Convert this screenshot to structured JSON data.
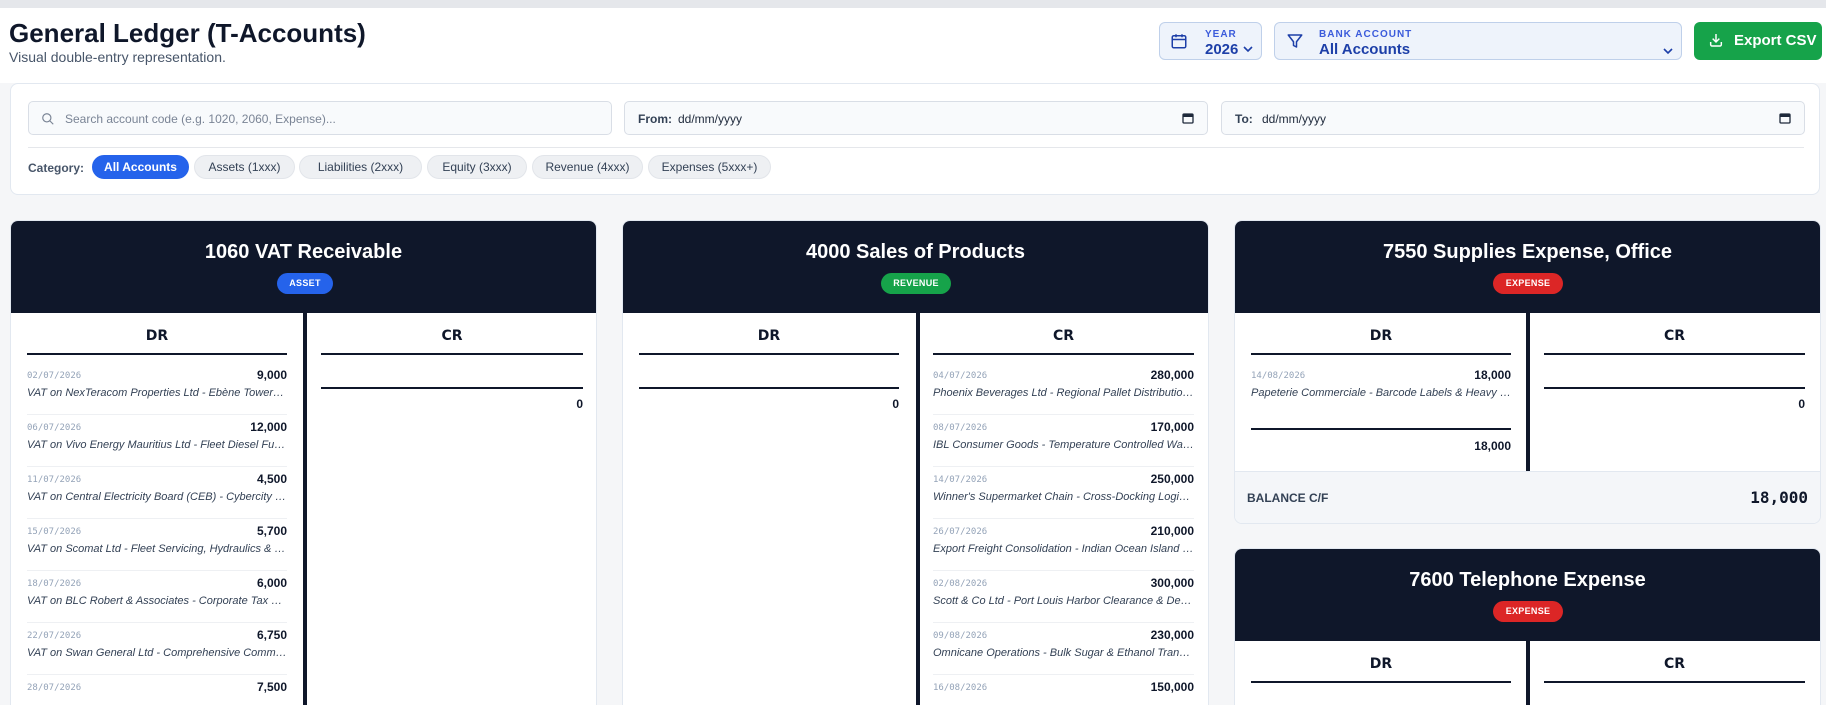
{
  "page": {
    "title": "General Ledger (T-Accounts)",
    "subtitle": "Visual double-entry representation."
  },
  "year_selector": {
    "label": "YEAR",
    "value": "2026"
  },
  "bank_selector": {
    "label": "BANK ACCOUNT",
    "value": "All Accounts"
  },
  "export_button": {
    "label": "Export CSV"
  },
  "filters": {
    "search_placeholder": "Search account code (e.g. 1020, 2060, Expense)...",
    "from_label": "From:",
    "from_value": "dd/mm/yyyy",
    "to_label": "To:",
    "to_value": "dd/mm/yyyy",
    "category_label": "Category:",
    "categories": [
      "All Accounts",
      "Assets (1xxx)",
      "Liabilities (2xxx)",
      "Equity (3xxx)",
      "Revenue (4xxx)",
      "Expenses (5xxx+)"
    ],
    "active_category": "All Accounts"
  },
  "accounts": [
    {
      "title": "1060 VAT Receivable",
      "badge": "ASSET",
      "dr_label": "DR",
      "cr_label": "CR",
      "dr_entries": [
        {
          "date": "02/07/2026",
          "amount": "9,000",
          "desc": "VAT on NexTeracom Properties Ltd - Ebène Tower II Office Rent"
        },
        {
          "date": "06/07/2026",
          "amount": "12,000",
          "desc": "VAT on Vivo Energy Mauritius Ltd - Fleet Diesel Fuel Supply"
        },
        {
          "date": "11/07/2026",
          "amount": "4,500",
          "desc": "VAT on Central Electricity Board (CEB) - Cybercity Office Power"
        },
        {
          "date": "15/07/2026",
          "amount": "5,700",
          "desc": "VAT on Scomat Ltd - Fleet Servicing, Hydraulics & Brakes"
        },
        {
          "date": "18/07/2026",
          "amount": "6,000",
          "desc": "VAT on BLC Robert & Associates - Corporate Tax & Secretarial"
        },
        {
          "date": "22/07/2026",
          "amount": "6,750",
          "desc": "VAT on Swan General Ltd - Comprehensive Commercial Insurance"
        },
        {
          "date": "28/07/2026",
          "amount": "7,500",
          "desc": ""
        }
      ],
      "cr_total": "0"
    },
    {
      "title": "4000 Sales of Products",
      "badge": "REVENUE",
      "dr_label": "DR",
      "cr_label": "CR",
      "dr_total": "0",
      "cr_entries": [
        {
          "date": "04/07/2026",
          "amount": "280,000",
          "desc": "Phoenix Beverages Ltd - Regional Pallet Distribution Contract"
        },
        {
          "date": "08/07/2026",
          "amount": "170,000",
          "desc": "IBL Consumer Goods - Temperature Controlled Warehousing"
        },
        {
          "date": "14/07/2026",
          "amount": "250,000",
          "desc": "Winner's Supermarket Chain - Cross-Docking Logistics"
        },
        {
          "date": "26/07/2026",
          "amount": "210,000",
          "desc": "Export Freight Consolidation - Indian Ocean Island Transit"
        },
        {
          "date": "02/08/2026",
          "amount": "300,000",
          "desc": "Scott & Co Ltd - Port Louis Harbor Clearance & Delivery"
        },
        {
          "date": "09/08/2026",
          "amount": "230,000",
          "desc": "Omnicane Operations - Bulk Sugar & Ethanol Transport"
        },
        {
          "date": "16/08/2026",
          "amount": "150,000",
          "desc": ""
        }
      ]
    },
    {
      "title": "7550 Supplies Expense, Office",
      "badge": "EXPENSE",
      "dr_label": "DR",
      "cr_label": "CR",
      "dr_entries": [
        {
          "date": "14/08/2026",
          "amount": "18,000",
          "desc": "Papeterie Commerciale - Barcode Labels & Heavy Packing Tape"
        }
      ],
      "dr_total": "18,000",
      "cr_total": "0",
      "balance_label": "BALANCE C/F",
      "balance_value": "18,000"
    },
    {
      "title": "7600 Telephone Expense",
      "badge": "EXPENSE",
      "dr_label": "DR",
      "cr_label": "CR"
    }
  ],
  "colors": {
    "card_header": "#0f172a",
    "asset": "#2563eb",
    "revenue": "#16a34a",
    "expense": "#dc2626",
    "export": "#16a34a"
  }
}
